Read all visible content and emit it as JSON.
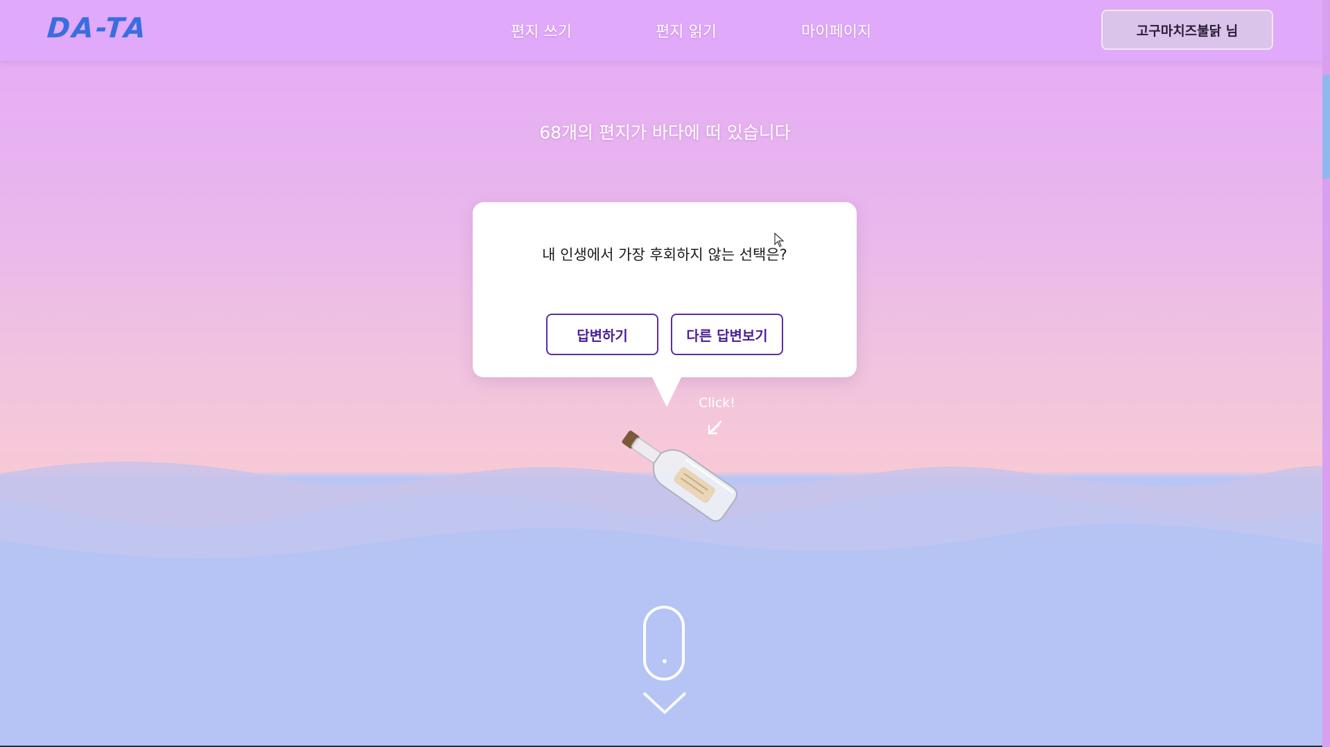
{
  "header": {
    "logo": "DA-TA",
    "nav": {
      "write": "편지 쓰기",
      "read": "편지 읽기",
      "mypage": "마이페이지"
    },
    "user_button": "고구마치즈불닭 님"
  },
  "main": {
    "count_text": "68개의 편지가 바다에 떠 있습니다",
    "popup": {
      "question": "내 인생에서 가장 후회하지 않는 선택은?",
      "answer_button": "답변하기",
      "others_button": "다른 답변보기"
    },
    "click_hint": "Click!"
  },
  "colors": {
    "header_bg": "#e0a9f9",
    "logo": "#3a6ee0",
    "button_border": "#5a2aa6",
    "ocean": "#b5c4f5"
  },
  "icons": {
    "bottle": "message-bottle-icon",
    "click_arrow": "arrow-down-left-icon",
    "scroll": "mouse-scroll-icon",
    "chevron": "chevron-down-icon",
    "cursor": "mouse-cursor-icon"
  }
}
